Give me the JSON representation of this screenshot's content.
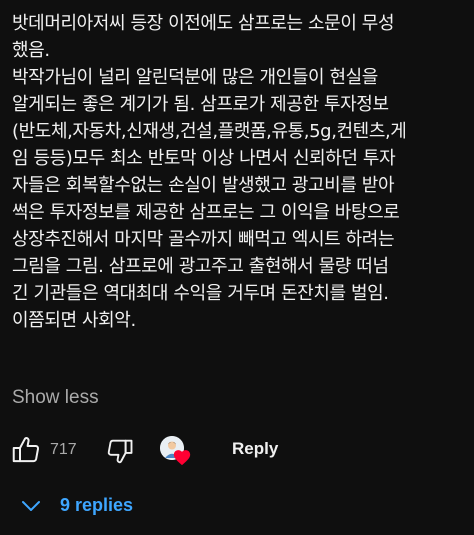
{
  "comment": {
    "lines": [
      "밧데머리아저씨 등장 이전에도 삼프로는 소문이 무성",
      "했음.",
      "박작가님이 널리 알린덕분에  많은 개인들이 현실을",
      "알게되는 좋은 계기가 됨. 삼프로가 제공한 투자정보",
      "(반도체,자동차,신재생,건설,플랫폼,유통,5g,컨텐츠,게",
      "임 등등)모두 최소 반토막 이상 나면서 신뢰하던 투자",
      "자들은 회복할수없는 손실이 발생했고 광고비를 받아",
      "썩은 투자정보를 제공한 삼프로는 그 이익을 바탕으로",
      "상장추진해서 마지막 골수까지 빼먹고 엑시트 하려는",
      "그림을 그림. 삼프로에 광고주고 출현해서 물량 떠넘",
      "긴 기관들은 역대최대 수익을 거두며 돈잔치를 벌임.",
      "이쯤되면 사회악."
    ],
    "show_less_label": "Show less"
  },
  "actions": {
    "like_count": "717",
    "reply_label": "Reply",
    "like_icon": "thumbs-up-icon",
    "dislike_icon": "thumbs-down-icon",
    "heart_color": "#ff0033"
  },
  "replies": {
    "label": "9 replies",
    "color": "#3ea6ff"
  }
}
